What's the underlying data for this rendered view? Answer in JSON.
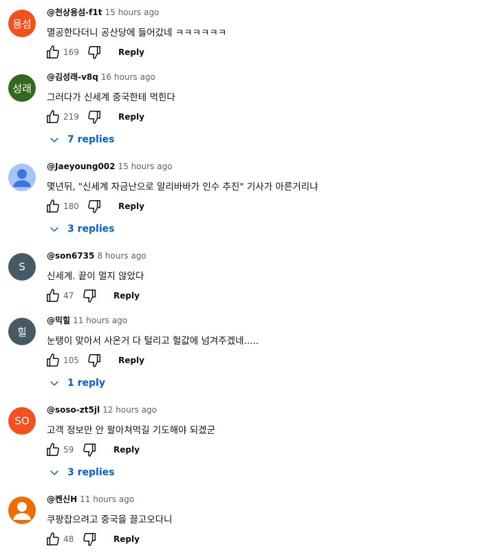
{
  "comments": [
    {
      "avatar_text": "용섬",
      "avatar_color": "#f4511e",
      "author": "@천상용섬-f1t",
      "time": "15 hours ago",
      "text": "멸공한다더니 공산당에 들어갔네 ㅋㅋㅋㅋㅋㅋ",
      "likes": "169",
      "reply": "Reply",
      "replies": ""
    },
    {
      "avatar_text": "성래",
      "avatar_color": "#33691e",
      "author": "@김성래-v8q",
      "time": "16 hours ago",
      "text": "그러다가 신세계 중국한테 먹힌다",
      "likes": "219",
      "reply": "Reply",
      "replies": "7 replies"
    },
    {
      "avatar_text": "",
      "avatar_color": "#a6c5f7",
      "author": "@Jaeyoung002",
      "time": "15 hours ago",
      "text": "몇년뒤, \"신세계 자금난으로 알리바바가 인수 추진\" 기사가 아른거리냐",
      "likes": "180",
      "reply": "Reply",
      "replies": "3 replies"
    },
    {
      "avatar_text": "S",
      "avatar_color": "#455a64",
      "author": "@son6735",
      "time": "8 hours ago",
      "text": "신세계. 끝이 멀지 않았다",
      "likes": "47",
      "reply": "Reply",
      "replies": ""
    },
    {
      "avatar_text": "힐",
      "avatar_color": "#455a64",
      "author": "@믹힐",
      "time": "11 hours ago",
      "text": "눈탱이 맞아서 사온거 다 털리고 헐값에 넘겨주겠네.....",
      "likes": "105",
      "reply": "Reply",
      "replies": "1 reply"
    },
    {
      "avatar_text": "SO",
      "avatar_color": "#f4511e",
      "author": "@soso-zt5jl",
      "time": "12 hours ago",
      "text": "고객 정보만 안 팔아쳐먹길 기도해야 되겠군",
      "likes": "59",
      "reply": "Reply",
      "replies": "3 replies"
    },
    {
      "avatar_text": "",
      "avatar_color": "#ef6c00",
      "author": "@켄신H",
      "time": "11 hours ago",
      "text": "쿠팡잡으려고 중국을 끌고오다니",
      "likes": "48",
      "reply": "Reply",
      "replies": ""
    }
  ]
}
